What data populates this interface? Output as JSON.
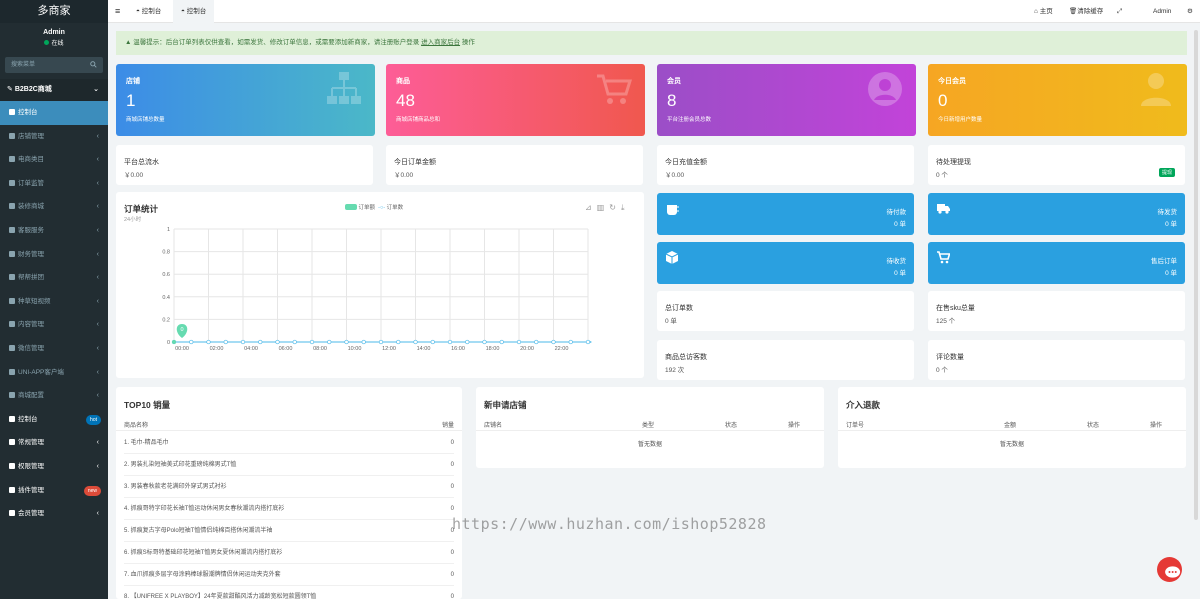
{
  "app": {
    "logo": "多商家",
    "user": "Admin",
    "status": "在线",
    "search_placeholder": "搜索菜单"
  },
  "sidebar": {
    "group": "B2B2C商城",
    "items": [
      {
        "label": "控制台",
        "icon": "dashboard-icon",
        "active": true
      },
      {
        "label": "店铺管理"
      },
      {
        "label": "电商类目"
      },
      {
        "label": "订单监管"
      },
      {
        "label": "装修商城"
      },
      {
        "label": "客服服务"
      },
      {
        "label": "财务管理"
      },
      {
        "label": "帮帮拼团"
      },
      {
        "label": "种草短视频"
      },
      {
        "label": "内容管理"
      },
      {
        "label": "微信管理"
      },
      {
        "label": "UNI-APP客户端"
      },
      {
        "label": "商城配置"
      }
    ],
    "bottom": [
      {
        "label": "控制台",
        "badge": "hot",
        "badge_color": "#0073b7"
      },
      {
        "label": "常规管理"
      },
      {
        "label": "权限管理"
      },
      {
        "label": "插件管理",
        "badge": "new",
        "badge_color": "#dd4b39"
      },
      {
        "label": "会员管理"
      }
    ]
  },
  "topbar": {
    "tabs": [
      "控制台",
      "控制台"
    ],
    "home": "主页",
    "clear_cache": "清除缓存",
    "admin": "Admin"
  },
  "alert": {
    "text": "温馨提示：后台订单列表仅供查看，如需发货、修改订单信息，或需要添加新商家，请注册账户登录 ",
    "link": "进入商家后台",
    "suffix": " 操作"
  },
  "stats": [
    {
      "title": "店铺",
      "value": "1",
      "sub": "商城店铺总数量",
      "color1": "#3c8ce7",
      "color2": "#4bb8c8"
    },
    {
      "title": "商品",
      "value": "48",
      "sub": "商城店铺商品总和",
      "color1": "#fd5d97",
      "color2": "#f0584e"
    },
    {
      "title": "会员",
      "value": "8",
      "sub": "平台注册会员总数",
      "color1": "#9b4ec7",
      "color2": "#c243d9"
    },
    {
      "title": "今日会员",
      "value": "0",
      "sub": "今日新增用户数量",
      "color1": "#f6a623",
      "color2": "#f0bb1c"
    }
  ],
  "money": [
    {
      "title": "平台总流水",
      "value": "￥0.00"
    },
    {
      "title": "今日订单金额",
      "value": "￥0.00"
    },
    {
      "title": "今日充值金额",
      "value": "￥0.00"
    },
    {
      "title": "待处理提现",
      "value": "0 个",
      "tag": "提现"
    }
  ],
  "order_chart": {
    "title": "订单统计",
    "subtitle": "24小时",
    "legend": [
      "订单额",
      "订单数"
    ]
  },
  "chart_data": {
    "type": "line",
    "x": [
      "00:00",
      "02:00",
      "04:00",
      "06:00",
      "08:00",
      "10:00",
      "12:00",
      "14:00",
      "16:00",
      "18:00",
      "20:00",
      "22:00"
    ],
    "series": [
      {
        "name": "订单额",
        "values": [
          0,
          0,
          0,
          0,
          0,
          0,
          0,
          0,
          0,
          0,
          0,
          0
        ]
      },
      {
        "name": "订单数",
        "values": [
          0,
          0,
          0,
          0,
          0,
          0,
          0,
          0,
          0,
          0,
          0,
          0
        ]
      }
    ],
    "y_ticks": [
      "0",
      "0.2",
      "0.4",
      "0.6",
      "0.8",
      "1"
    ],
    "ylim": [
      0,
      1
    ],
    "marker_label": "0"
  },
  "quick": [
    {
      "label": "待付款",
      "value": "0 单",
      "icon": "coffee-icon"
    },
    {
      "label": "待发货",
      "value": "0 单",
      "icon": "truck-icon"
    },
    {
      "label": "待收货",
      "value": "0 单",
      "icon": "cube-icon"
    },
    {
      "label": "售后订单",
      "value": "0 单",
      "icon": "cart-icon"
    }
  ],
  "summary": [
    {
      "title": "总订单数",
      "value": "0 单"
    },
    {
      "title": "在售sku总量",
      "value": "125 个"
    },
    {
      "title": "商品总访客数",
      "value": "192 次"
    },
    {
      "title": "评论数量",
      "value": "0 个"
    }
  ],
  "top10": {
    "title": "TOP10 销量",
    "col1": "商品名称",
    "col2": "销量",
    "rows": [
      {
        "name": "1. 毛巾-精品毛巾",
        "qty": "0"
      },
      {
        "name": "2. 男装扎染短袖美式印花重磅纯棉男式T恤",
        "qty": "0"
      },
      {
        "name": "3. 男装春秋款老花满印外穿式男式衬衫",
        "qty": "0"
      },
      {
        "name": "4. 抓痕哥特字印花长袖T恤运动休闲男女春秋潮流内搭打底衫",
        "qty": "0"
      },
      {
        "name": "5. 抓痕复古字母Polo短袖T恤情侣纯棉百搭休闲潮流半袖",
        "qty": "0"
      },
      {
        "name": "6. 抓痕S标哥特基础印花短袖T恤男女夏休闲潮流内搭打底衫",
        "qty": "0"
      },
      {
        "name": "7. 血爪抓痕多层字母涂鸦棒球服潮牌情侣休闲运动夹克外套",
        "qty": "0"
      },
      {
        "name": "8. 【UNIFREE X PLAYBOY】24年夏款甜酷风活力减龄宽松短款圆领T恤",
        "qty": "0"
      }
    ]
  },
  "new_shops": {
    "title": "新申请店铺",
    "cols": [
      "店铺名",
      "类型",
      "状态",
      "操作"
    ],
    "empty": "暂无数据"
  },
  "refunds": {
    "title": "介入退款",
    "cols": [
      "订单号",
      "金额",
      "状态",
      "操作"
    ],
    "empty": "暂无数据"
  },
  "watermark": "https://www.huzhan.com/ishop52828"
}
